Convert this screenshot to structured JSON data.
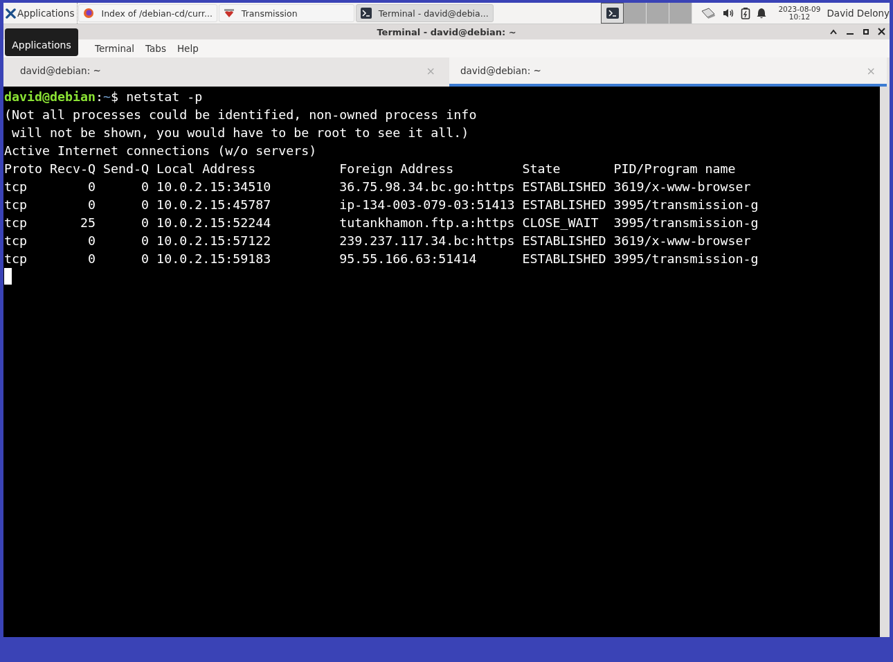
{
  "taskbar": {
    "apps_button": "Applications",
    "tasks": [
      {
        "kind": "browser",
        "label": "Index of /debian-cd/curr...",
        "selected": false
      },
      {
        "kind": "torrent",
        "label": "Transmission",
        "selected": false
      },
      {
        "kind": "terminal",
        "label": "Terminal - david@debia...",
        "selected": true
      }
    ],
    "workspaces": [
      {
        "selected": true
      },
      {
        "selected": false
      },
      {
        "selected": false
      },
      {
        "selected": false
      }
    ],
    "date": "2023-08-09",
    "time": "10:12",
    "user": "David Delony"
  },
  "window": {
    "title": "Terminal - david@debian: ~"
  },
  "tooltip": "Applications",
  "menu": [
    "Terminal",
    "Tabs",
    "Help"
  ],
  "tabs": [
    {
      "label": "david@debian: ~",
      "close": "×",
      "selected": false
    },
    {
      "label": "david@debian: ~",
      "close": "×",
      "selected": true
    }
  ],
  "terminal": {
    "prompt": {
      "user": "david@debian",
      "sep": ":",
      "path": "~",
      "symbol": "$",
      "command": " netstat -p"
    },
    "lines": [
      "(Not all processes could be identified, non-owned process info",
      " will not be shown, you would have to be root to see it all.)",
      "Active Internet connections (w/o servers)",
      "Proto Recv-Q Send-Q Local Address           Foreign Address         State       PID/Program name",
      "tcp        0      0 10.0.2.15:34510         36.75.98.34.bc.go:https ESTABLISHED 3619/x-www-browser",
      "tcp        0      0 10.0.2.15:45787         ip-134-003-079-03:51413 ESTABLISHED 3995/transmission-g",
      "tcp       25      0 10.0.2.15:52244         tutankhamon.ftp.a:https CLOSE_WAIT  3995/transmission-g",
      "tcp        0      0 10.0.2.15:57122         239.237.117.34.bc:https ESTABLISHED 3619/x-www-browser",
      "tcp        0      0 10.0.2.15:59183         95.55.166.63:51414      ESTABLISHED 3995/transmission-g"
    ]
  }
}
